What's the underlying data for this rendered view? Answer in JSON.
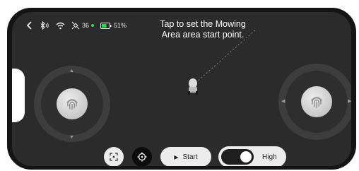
{
  "status": {
    "back_icon": "chevron-left-icon",
    "bluetooth_icon": "bluetooth-icon",
    "wifi_icon": "wifi-icon",
    "satellite_count": "36",
    "satellite_status_color": "#39d353",
    "battery": "51%"
  },
  "hint": {
    "line1": "Tap to set the Mowing",
    "line2": "Area area start point."
  },
  "controls": {
    "start_label": "Start",
    "mode_label": "High",
    "mode_toggle_on": true
  }
}
